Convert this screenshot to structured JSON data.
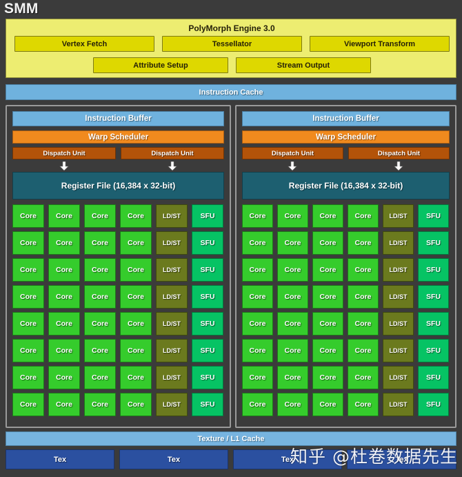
{
  "diagram": {
    "title": "SMM",
    "background_color": "#3b3b3b"
  },
  "polymorph": {
    "title": "PolyMorph Engine 3.0",
    "panel_color": "#eded71",
    "button_color": "#ded800",
    "row1": [
      {
        "label": "Vertex Fetch"
      },
      {
        "label": "Tessellator"
      },
      {
        "label": "Viewport Transform"
      }
    ],
    "row2": [
      {
        "label": "Attribute Setup"
      },
      {
        "label": "Stream Output"
      }
    ]
  },
  "instruction_cache": {
    "label": "Instruction Cache",
    "color": "#6fb2de"
  },
  "processing_blocks": [
    {
      "instruction_buffer": "Instruction Buffer",
      "warp_scheduler": "Warp Scheduler",
      "dispatch_units": [
        "Dispatch Unit",
        "Dispatch Unit"
      ],
      "register_file": "Register File (16,384 x 32-bit)"
    },
    {
      "instruction_buffer": "Instruction Buffer",
      "warp_scheduler": "Warp Scheduler",
      "dispatch_units": [
        "Dispatch Unit",
        "Dispatch Unit"
      ],
      "register_file": "Register File (16,384 x 32-bit)"
    }
  ],
  "core_grid": {
    "rows": 8,
    "columns": [
      "Core",
      "Core",
      "Core",
      "Core",
      "LD/ST",
      "SFU"
    ],
    "labels": {
      "core": "Core",
      "ldst": "LD/ST",
      "sfu": "SFU"
    },
    "colors": {
      "core": "#35cc2c",
      "ldst": "#6b7a1e",
      "sfu": "#06c364"
    }
  },
  "texture_cache": {
    "label": "Texture / L1 Cache",
    "color": "#77b4e0"
  },
  "tex_units": {
    "color": "#2b50a0",
    "items": [
      "Tex",
      "Tex",
      "Tex",
      "Tex"
    ]
  },
  "watermark": {
    "text": "知乎 @杜卷数据先生"
  }
}
